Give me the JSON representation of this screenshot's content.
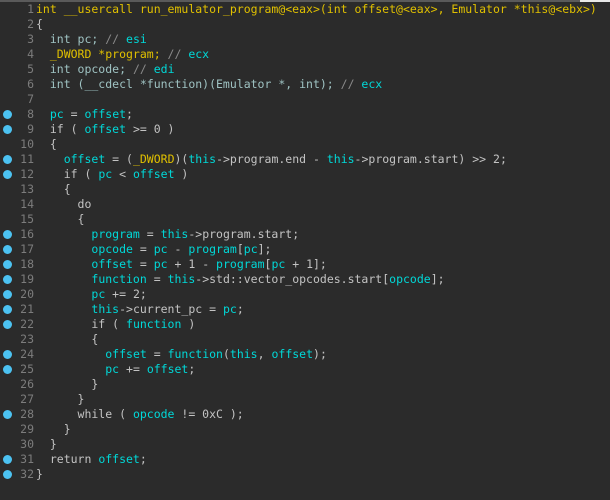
{
  "colors": {
    "background": "#2b2b2b",
    "variable": "#00d8d8",
    "highlight": "#e0c000",
    "keyword": "#c3c3c3",
    "breakpoint_dot": "#4cc2f1"
  },
  "lines": [
    {
      "n": "1",
      "dot": false,
      "tokens": [
        [
          "int __usercall run_emulator_program@<eax>(int offset@<eax>, Emulator *this@<ebx>)",
          "y"
        ]
      ]
    },
    {
      "n": "2",
      "dot": false,
      "tokens": [
        [
          "{",
          "k"
        ]
      ]
    },
    {
      "n": "3",
      "dot": false,
      "tokens": [
        [
          "  int pc; ",
          "t"
        ],
        [
          "// ",
          "c"
        ],
        [
          "esi",
          "v"
        ]
      ]
    },
    {
      "n": "4",
      "dot": false,
      "tokens": [
        [
          "  _DWORD *program;",
          "y"
        ],
        [
          " // ",
          "c"
        ],
        [
          "ecx",
          "v"
        ]
      ]
    },
    {
      "n": "5",
      "dot": false,
      "tokens": [
        [
          "  int opcode; ",
          "t"
        ],
        [
          "// ",
          "c"
        ],
        [
          "edi",
          "v"
        ]
      ]
    },
    {
      "n": "6",
      "dot": false,
      "tokens": [
        [
          "  int (__cdecl *function)(Emulator *, int); ",
          "t"
        ],
        [
          "// ",
          "c"
        ],
        [
          "ecx",
          "v"
        ]
      ]
    },
    {
      "n": "7",
      "dot": false,
      "tokens": []
    },
    {
      "n": "8",
      "dot": true,
      "tokens": [
        [
          "  ",
          "k"
        ],
        [
          "pc",
          "v"
        ],
        [
          " = ",
          "k"
        ],
        [
          "offset",
          "v"
        ],
        [
          ";",
          "k"
        ]
      ]
    },
    {
      "n": "9",
      "dot": true,
      "tokens": [
        [
          "  if ( ",
          "k"
        ],
        [
          "offset",
          "v"
        ],
        [
          " >= 0 )",
          "k"
        ]
      ]
    },
    {
      "n": "10",
      "dot": false,
      "tokens": [
        [
          "  {",
          "k"
        ]
      ]
    },
    {
      "n": "11",
      "dot": true,
      "tokens": [
        [
          "    ",
          "k"
        ],
        [
          "offset",
          "v"
        ],
        [
          " = (",
          "k"
        ],
        [
          "_DWORD",
          "y"
        ],
        [
          ")(",
          "k"
        ],
        [
          "this",
          "v"
        ],
        [
          "->program.end - ",
          "k"
        ],
        [
          "this",
          "v"
        ],
        [
          "->program.start) >> 2;",
          "k"
        ]
      ]
    },
    {
      "n": "12",
      "dot": true,
      "tokens": [
        [
          "    if ( ",
          "k"
        ],
        [
          "pc",
          "v"
        ],
        [
          " < ",
          "k"
        ],
        [
          "offset",
          "v"
        ],
        [
          " )",
          "k"
        ]
      ]
    },
    {
      "n": "13",
      "dot": false,
      "tokens": [
        [
          "    {",
          "k"
        ]
      ]
    },
    {
      "n": "14",
      "dot": false,
      "tokens": [
        [
          "      do",
          "k"
        ]
      ]
    },
    {
      "n": "15",
      "dot": false,
      "tokens": [
        [
          "      {",
          "k"
        ]
      ]
    },
    {
      "n": "16",
      "dot": true,
      "tokens": [
        [
          "        ",
          "k"
        ],
        [
          "program",
          "v"
        ],
        [
          " = ",
          "k"
        ],
        [
          "this",
          "v"
        ],
        [
          "->program.start;",
          "k"
        ]
      ]
    },
    {
      "n": "17",
      "dot": true,
      "tokens": [
        [
          "        ",
          "k"
        ],
        [
          "opcode",
          "v"
        ],
        [
          " = ",
          "k"
        ],
        [
          "pc",
          "v"
        ],
        [
          " - ",
          "k"
        ],
        [
          "program",
          "v"
        ],
        [
          "[",
          "k"
        ],
        [
          "pc",
          "v"
        ],
        [
          "];",
          "k"
        ]
      ]
    },
    {
      "n": "18",
      "dot": true,
      "tokens": [
        [
          "        ",
          "k"
        ],
        [
          "offset",
          "v"
        ],
        [
          " = ",
          "k"
        ],
        [
          "pc",
          "v"
        ],
        [
          " + 1 - ",
          "k"
        ],
        [
          "program",
          "v"
        ],
        [
          "[",
          "k"
        ],
        [
          "pc",
          "v"
        ],
        [
          " + 1];",
          "k"
        ]
      ]
    },
    {
      "n": "19",
      "dot": true,
      "tokens": [
        [
          "        ",
          "k"
        ],
        [
          "function",
          "v"
        ],
        [
          " = ",
          "k"
        ],
        [
          "this",
          "v"
        ],
        [
          "->std::vector_opcodes.start[",
          "k"
        ],
        [
          "opcode",
          "v"
        ],
        [
          "];",
          "k"
        ]
      ]
    },
    {
      "n": "20",
      "dot": true,
      "tokens": [
        [
          "        ",
          "k"
        ],
        [
          "pc",
          "v"
        ],
        [
          " += 2;",
          "k"
        ]
      ]
    },
    {
      "n": "21",
      "dot": true,
      "tokens": [
        [
          "        ",
          "k"
        ],
        [
          "this",
          "v"
        ],
        [
          "->current_pc = ",
          "k"
        ],
        [
          "pc",
          "v"
        ],
        [
          ";",
          "k"
        ]
      ]
    },
    {
      "n": "22",
      "dot": true,
      "tokens": [
        [
          "        if ( ",
          "k"
        ],
        [
          "function",
          "v"
        ],
        [
          " )",
          "k"
        ]
      ]
    },
    {
      "n": "23",
      "dot": false,
      "tokens": [
        [
          "        {",
          "k"
        ]
      ]
    },
    {
      "n": "24",
      "dot": true,
      "tokens": [
        [
          "          ",
          "k"
        ],
        [
          "offset",
          "v"
        ],
        [
          " = ",
          "k"
        ],
        [
          "function",
          "v"
        ],
        [
          "(",
          "k"
        ],
        [
          "this",
          "v"
        ],
        [
          ", ",
          "k"
        ],
        [
          "offset",
          "v"
        ],
        [
          ");",
          "k"
        ]
      ]
    },
    {
      "n": "25",
      "dot": true,
      "tokens": [
        [
          "          ",
          "k"
        ],
        [
          "pc",
          "v"
        ],
        [
          " += ",
          "k"
        ],
        [
          "offset",
          "v"
        ],
        [
          ";",
          "k"
        ]
      ]
    },
    {
      "n": "26",
      "dot": false,
      "tokens": [
        [
          "        }",
          "k"
        ]
      ]
    },
    {
      "n": "27",
      "dot": false,
      "tokens": [
        [
          "      }",
          "k"
        ]
      ]
    },
    {
      "n": "28",
      "dot": true,
      "tokens": [
        [
          "      while ( ",
          "k"
        ],
        [
          "opcode",
          "v"
        ],
        [
          " != 0xC );",
          "k"
        ]
      ]
    },
    {
      "n": "29",
      "dot": false,
      "tokens": [
        [
          "    }",
          "k"
        ]
      ]
    },
    {
      "n": "30",
      "dot": false,
      "tokens": [
        [
          "  }",
          "k"
        ]
      ]
    },
    {
      "n": "31",
      "dot": true,
      "tokens": [
        [
          "  return ",
          "k"
        ],
        [
          "offset",
          "v"
        ],
        [
          ";",
          "k"
        ]
      ]
    },
    {
      "n": "32",
      "dot": true,
      "tokens": [
        [
          "}",
          "k"
        ]
      ]
    }
  ]
}
